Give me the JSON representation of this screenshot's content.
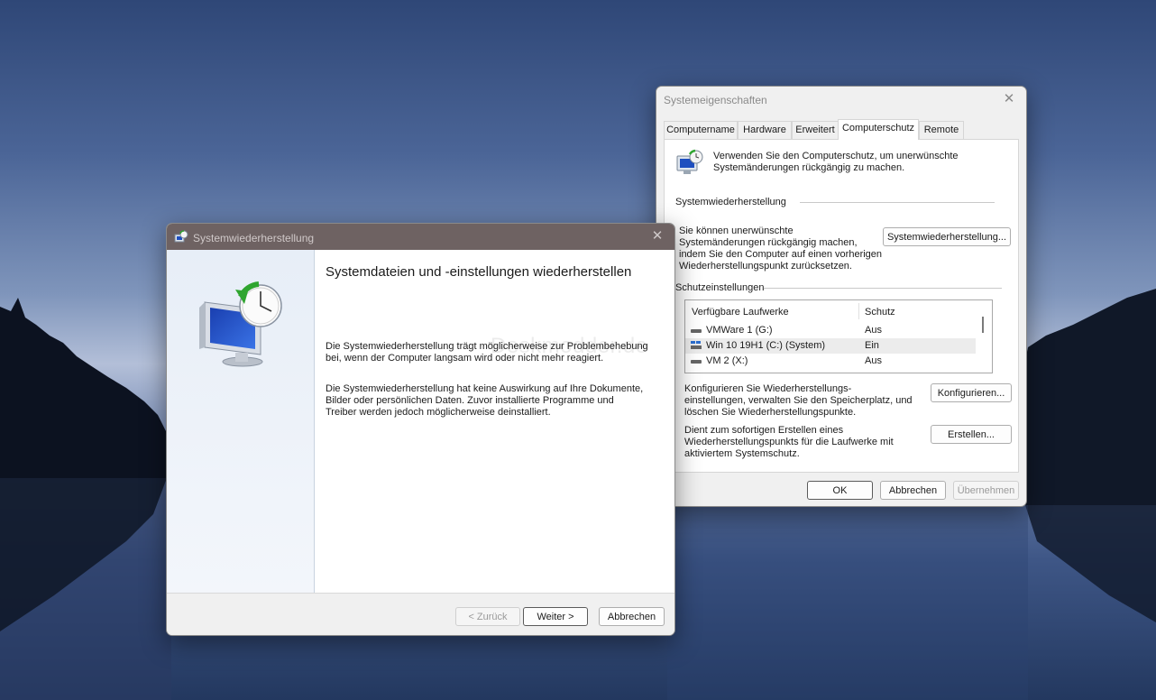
{
  "system_properties": {
    "title": "Systemeigenschaften",
    "tabs": [
      {
        "label": "Computername"
      },
      {
        "label": "Hardware"
      },
      {
        "label": "Erweitert"
      },
      {
        "label": "Computerschutz"
      },
      {
        "label": "Remote"
      }
    ],
    "active_tab": "Computerschutz",
    "intro_text_1": "Verwenden Sie den Computerschutz, um unerwünschte",
    "intro_text_2": "Systemänderungen rückgängig zu machen.",
    "restore_group_title": "Systemwiederherstellung",
    "restore_desc_1": "Sie können unerwünschte",
    "restore_desc_2": "Systemänderungen rückgängig machen,",
    "restore_desc_3": "indem Sie den Computer auf einen vorherigen",
    "restore_desc_4": "Wiederherstellungspunkt zurücksetzen.",
    "restore_button": "Systemwiederherstellung...",
    "protection_group_title": "Schutzeinstellungen",
    "list_headers": {
      "drives": "Verfügbare Laufwerke",
      "protection": "Schutz"
    },
    "drives": [
      {
        "name": "VMWare 1 (G:)",
        "protection": "Aus"
      },
      {
        "name": "Win 10 19H1 (C:) (System)",
        "protection": "Ein"
      },
      {
        "name": "VM 2 (X:)",
        "protection": "Aus"
      }
    ],
    "configure_desc_1": "Konfigurieren Sie Wiederherstellungs-",
    "configure_desc_2": "einstellungen, verwalten Sie den Speicherplatz, und",
    "configure_desc_3": "löschen Sie Wiederherstellungspunkte.",
    "configure_button": "Konfigurieren...",
    "create_desc_1": "Dient zum sofortigen Erstellen eines",
    "create_desc_2": "Wiederherstellungspunkts für die Laufwerke mit",
    "create_desc_3": "aktiviertem Systemschutz.",
    "create_button": "Erstellen...",
    "ok_button": "OK",
    "cancel_button": "Abbrechen",
    "apply_button": "Übernehmen"
  },
  "system_restore": {
    "title": "Systemwiederherstellung",
    "heading": "Systemdateien und -einstellungen wiederherstellen",
    "para1_line1": "Die Systemwiederherstellung trägt möglicherweise zur Problembehebung",
    "para1_line2": "bei, wenn der Computer langsam wird oder nicht mehr reagiert.",
    "para2_line1": "Die Systemwiederherstellung hat keine Auswirkung auf Ihre Dokumente,",
    "para2_line2": "Bilder oder persönlichen Daten. Zuvor installierte Programme und",
    "para2_line3": "Treiber werden jedoch möglicherweise deinstalliert.",
    "back_button": "< Zurück",
    "next_button": "Weiter >",
    "cancel_button": "Abbrechen",
    "watermark": "Deskmodder.de"
  },
  "colors": {
    "accent_blue": "#1f4fbf",
    "titlebar_dark": "#6e6262",
    "selected_row": "#ececec"
  }
}
